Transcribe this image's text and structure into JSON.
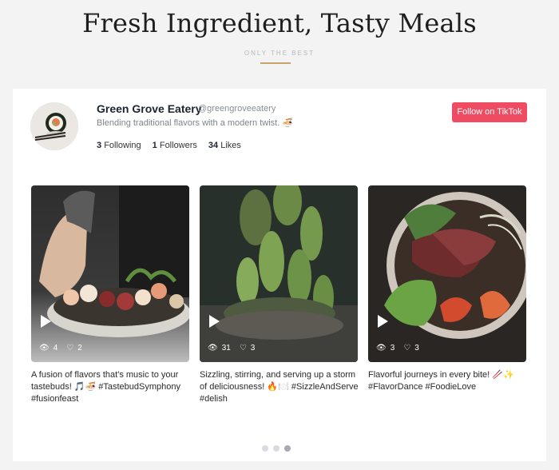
{
  "header": {
    "title": "Fresh Ingredient, Tasty Meals",
    "subtitle": "ONLY THE BEST"
  },
  "profile": {
    "name": "Green Grove Eatery",
    "handle": "@greengroveeatery",
    "bio": "Blending traditional flavors with a modern twist. 🍜",
    "following_count": "3",
    "following_label": "Following",
    "followers_count": "1",
    "followers_label": "Followers",
    "likes_count": "34",
    "likes_label": "Likes",
    "follow_button": "Follow on TikTok"
  },
  "videos": [
    {
      "views": "4",
      "likes": "2",
      "caption": "A fusion of flavors that's music to your tastebuds! 🎵🍜 #TastebudSymphony #fusionfeast"
    },
    {
      "views": "31",
      "likes": "3",
      "caption": "Sizzling, stirring, and serving up a storm of deliciousness! 🔥🍽️ #SizzleAndServe #delish"
    },
    {
      "views": "3",
      "likes": "3",
      "caption": "Flavorful journeys in every bite! 🥢✨ #FlavorDance #FoodieLove"
    }
  ],
  "pagination": {
    "total": 3,
    "active_index": 2
  },
  "colors": {
    "follow_button": "#ef4c63",
    "accent_line": "#c8a46a"
  }
}
